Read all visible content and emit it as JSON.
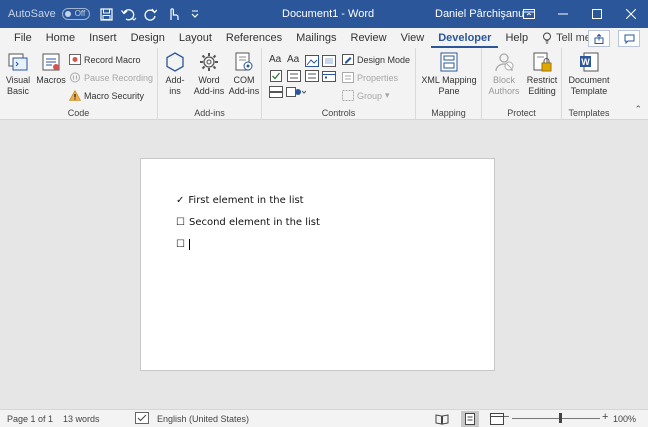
{
  "titlebar": {
    "autosave_label": "AutoSave",
    "autosave_state": "Off",
    "doc_title": "Document1 - Word",
    "user_name": "Daniel Pârchişanu"
  },
  "tabs": [
    {
      "label": "File"
    },
    {
      "label": "Home"
    },
    {
      "label": "Insert"
    },
    {
      "label": "Design"
    },
    {
      "label": "Layout"
    },
    {
      "label": "References"
    },
    {
      "label": "Mailings"
    },
    {
      "label": "Review"
    },
    {
      "label": "View"
    },
    {
      "label": "Developer"
    },
    {
      "label": "Help"
    }
  ],
  "tell_me": "Tell me ν",
  "ribbon": {
    "code": {
      "label": "Code",
      "visual_basic": "Visual\nBasic",
      "macros": "Macros",
      "record_macro": "Record Macro",
      "pause_recording": "Pause Recording",
      "macro_security": "Macro Security"
    },
    "addins": {
      "label": "Add-ins",
      "addins": "Add-\nins",
      "word_addins": "Word\nAdd-ins",
      "com_addins": "COM\nAdd-ins"
    },
    "controls": {
      "label": "Controls",
      "design_mode": "Design Mode",
      "properties": "Properties",
      "group": "Group"
    },
    "mapping": {
      "label": "Mapping",
      "xml_mapping_pane": "XML Mapping\nPane"
    },
    "protect": {
      "label": "Protect",
      "block_authors": "Block\nAuthors",
      "restrict_editing": "Restrict\nEditing"
    },
    "templates": {
      "label": "Templates",
      "document_template": "Document\nTemplate"
    }
  },
  "document": {
    "lines": [
      {
        "symbol": "✓",
        "text": "First element in the list"
      },
      {
        "symbol": "☐",
        "text": "Second element in the list"
      },
      {
        "symbol": "☐",
        "text": ""
      }
    ]
  },
  "status": {
    "page": "Page 1 of 1",
    "words": "13 words",
    "language": "English (United States)",
    "zoom": "100%",
    "zoom_minus": "−",
    "zoom_plus": "+"
  },
  "colors": {
    "word_blue": "#2b579a",
    "ribbon_bg": "#f3f3f3",
    "canvas_bg": "#e6e6e6"
  }
}
